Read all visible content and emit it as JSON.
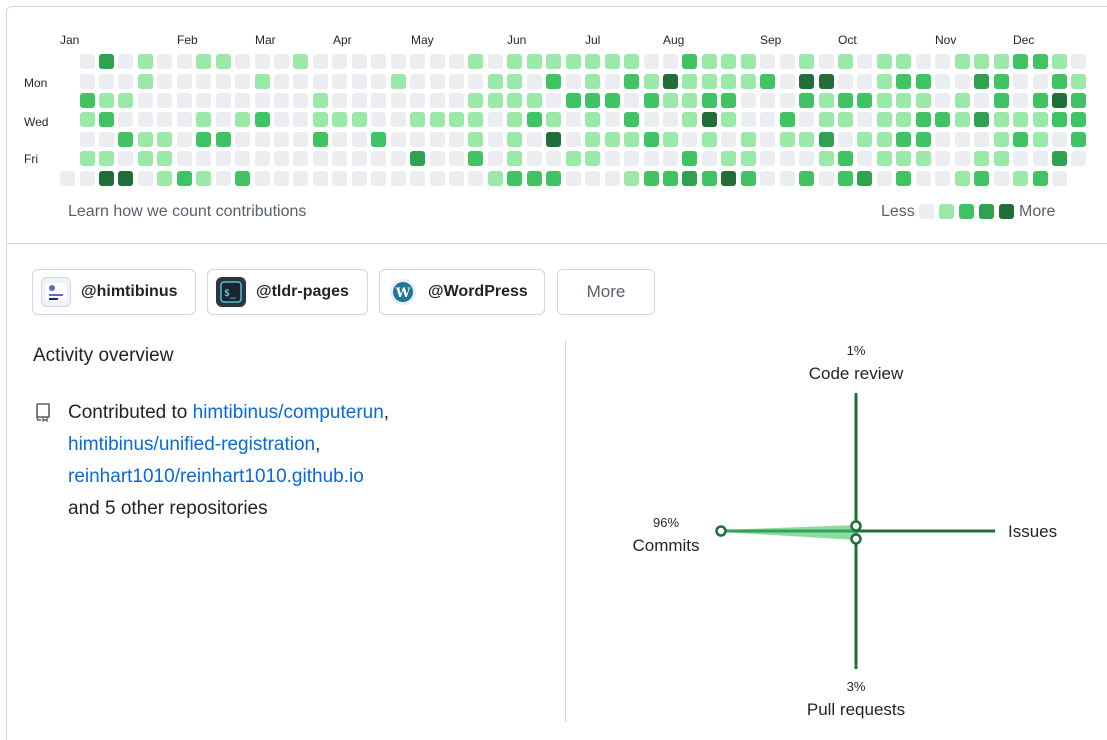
{
  "calendar": {
    "months": [
      "Jan",
      "Feb",
      "Mar",
      "Apr",
      "May",
      "Jun",
      "Jul",
      "Aug",
      "Sep",
      "Oct",
      "Nov",
      "Dec"
    ],
    "day_labels": [
      "Mon",
      "Wed",
      "Fri"
    ],
    "learn_link": "Learn how we count contributions",
    "legend_less": "Less",
    "legend_more": "More",
    "colors": [
      "#ebedf0",
      "#9be9a8",
      "#40c463",
      "#30a14e",
      "#216e39"
    ]
  },
  "orgs": [
    {
      "label": "@himtibinus",
      "icon": "himtibinus-logo"
    },
    {
      "label": "@tldr-pages",
      "icon": "terminal-icon"
    },
    {
      "label": "@WordPress",
      "icon": "wordpress-logo"
    }
  ],
  "more_button": "More",
  "activity": {
    "title": "Activity overview",
    "prefix": "Contributed to",
    "repos": [
      "himtibinus/computerun",
      "himtibinus/unified-registration",
      "reinhart1010/reinhart1010.github.io"
    ],
    "suffix": "and 5 other repositories"
  },
  "radar": {
    "code_review": {
      "label": "Code review",
      "pct": "1%"
    },
    "issues": {
      "label": "Issues",
      "pct": ""
    },
    "commits": {
      "label": "Commits",
      "pct": "96%"
    },
    "pull_requests": {
      "label": "Pull requests",
      "pct": "3%"
    },
    "color": "#216e39",
    "fill": "#40c463"
  }
}
